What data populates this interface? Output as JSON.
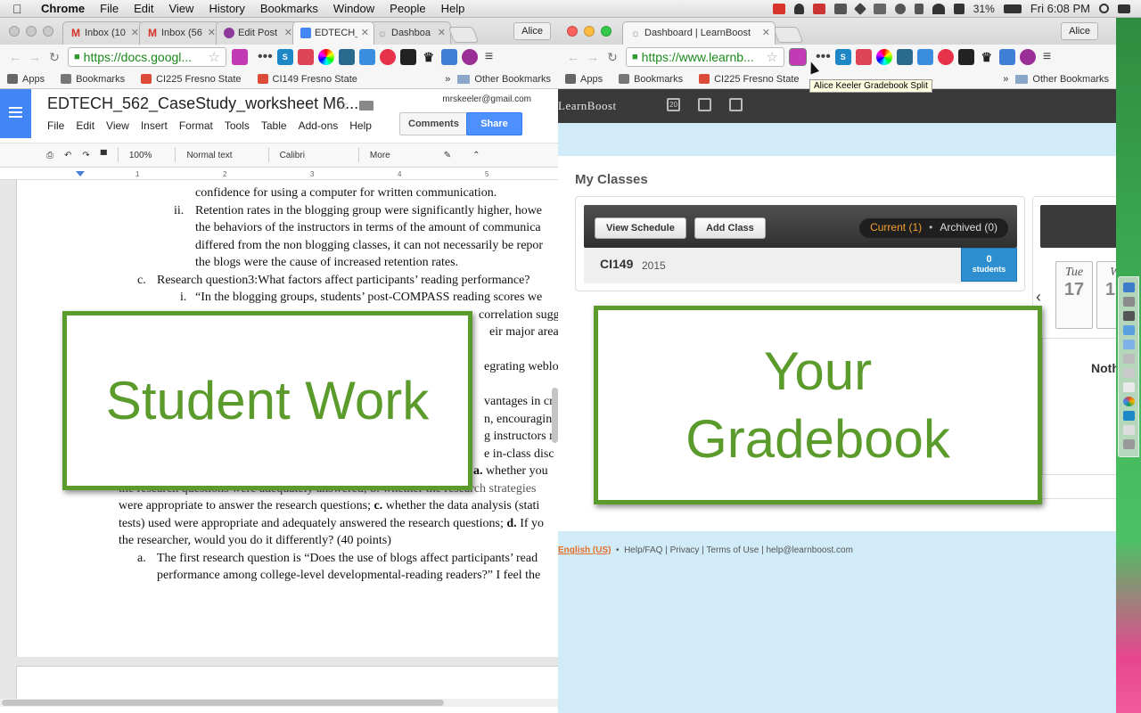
{
  "menubar": {
    "app_name": "Chrome",
    "items": [
      "File",
      "Edit",
      "View",
      "History",
      "Bookmarks",
      "Window",
      "People",
      "Help"
    ],
    "battery": "31%",
    "clock": "Fri 6:08 PM"
  },
  "docs_window": {
    "tabs": [
      {
        "label": "Inbox (10",
        "favicon": "gmail-icon",
        "color": "#d93025"
      },
      {
        "label": "Inbox (56",
        "favicon": "gmail-icon",
        "color": "#d93025"
      },
      {
        "label": "Edit Post",
        "favicon": "blog-icon",
        "color": "#8e3a9d"
      },
      {
        "label": "EDTECH_",
        "favicon": "docs-icon",
        "color": "#4285f4"
      },
      {
        "label": "Dashboa",
        "favicon": "learnboost-icon",
        "color": "#999999"
      }
    ],
    "profile": "Alice",
    "url": "https://docs.googl...",
    "bookmarks": {
      "apps": "Apps",
      "items": [
        "Bookmarks",
        "CI225 Fresno State",
        "CI149 Fresno State"
      ],
      "other": "Other Bookmarks"
    },
    "doc": {
      "title": "EDTECH_562_CaseStudy_worksheet M6...",
      "user_email": "mrskeeler@gmail.com",
      "menu": [
        "File",
        "Edit",
        "View",
        "Insert",
        "Format",
        "Tools",
        "Table",
        "Add-ons",
        "Help"
      ],
      "comments_label": "Comments",
      "share_label": "Share",
      "format_bar": {
        "zoom": "100%",
        "style": "Normal text",
        "font": "Calibri",
        "more": "More"
      },
      "ruler_ticks": [
        "1",
        "2",
        "3",
        "4",
        "5"
      ],
      "lines": [
        "confidence for using a computer for written communication.",
        "ii.",
        "Retention rates in the blogging group were significantly higher, howe",
        "the behaviors of the instructors in terms of the amount of communica",
        "differed from the non blogging classes, it can not necessarily be repor",
        "the blogs were the cause of increased retention rates.",
        "c.",
        "Research question3:What factors affect participants’ reading performance?",
        "i.",
        "“In the blogging groups, students’ post-COMPASS reading scores we",
        "correlation sugge",
        "eir major area",
        "egrating weblo",
        "vantages in cre",
        "n, encouraging",
        "g instructors m",
        "e in-class disc",
        "whether you",
        "the research questions were adequately answered; b. whether the research strategies",
        "were appropriate to answer the research questions;",
        "whether the data analysis (stati",
        "tests) used were appropriate and adequately answered the research questions;",
        "If yo",
        "the researcher, would you do it differently? (40 points)",
        "a.",
        "The first research question is “Does the use of blogs affect participants’ read",
        "performance among college-level developmental-reading readers?” I feel the"
      ],
      "bold_markers": [
        "a.",
        "c.",
        "d."
      ]
    }
  },
  "lb_window": {
    "tab_label": "Dashboard | LearnBoost",
    "profile": "Alice",
    "url": "https://www.learnb...",
    "bookmarks": {
      "apps": "Apps",
      "items": [
        "Bookmarks",
        "CI225 Fresno State"
      ],
      "other": "Other Bookmarks"
    },
    "tooltip": "Alice Keeler Gradebook Split",
    "logo": "LearnBoost",
    "calendar_icon_day": "20",
    "my_classes": "My Classes",
    "view_schedule": "View Schedule",
    "add_class": "Add Class",
    "filter_current": "Current (1)",
    "filter_archived": "Archived (0)",
    "class_name": "CI149",
    "class_year": "2015",
    "student_count": "0",
    "student_label": "students",
    "days": [
      {
        "name": "Tue",
        "num": "17"
      },
      {
        "name": "W",
        "num": "17"
      }
    ],
    "nothing": "Noth",
    "footer": {
      "lang": "English (US)",
      "links": [
        "Help/FAQ",
        "Privacy",
        "Terms of Use",
        "help@learnboost.com"
      ]
    }
  },
  "overlays": {
    "student_work": "Student Work",
    "gradebook_line1": "Your",
    "gradebook_line2": "Gradebook"
  },
  "colors": {
    "overlay_green": "#5a9b2c",
    "docs_blue": "#4285f4",
    "lb_blue": "#2d8ed0",
    "lb_orange": "#f0a030"
  }
}
